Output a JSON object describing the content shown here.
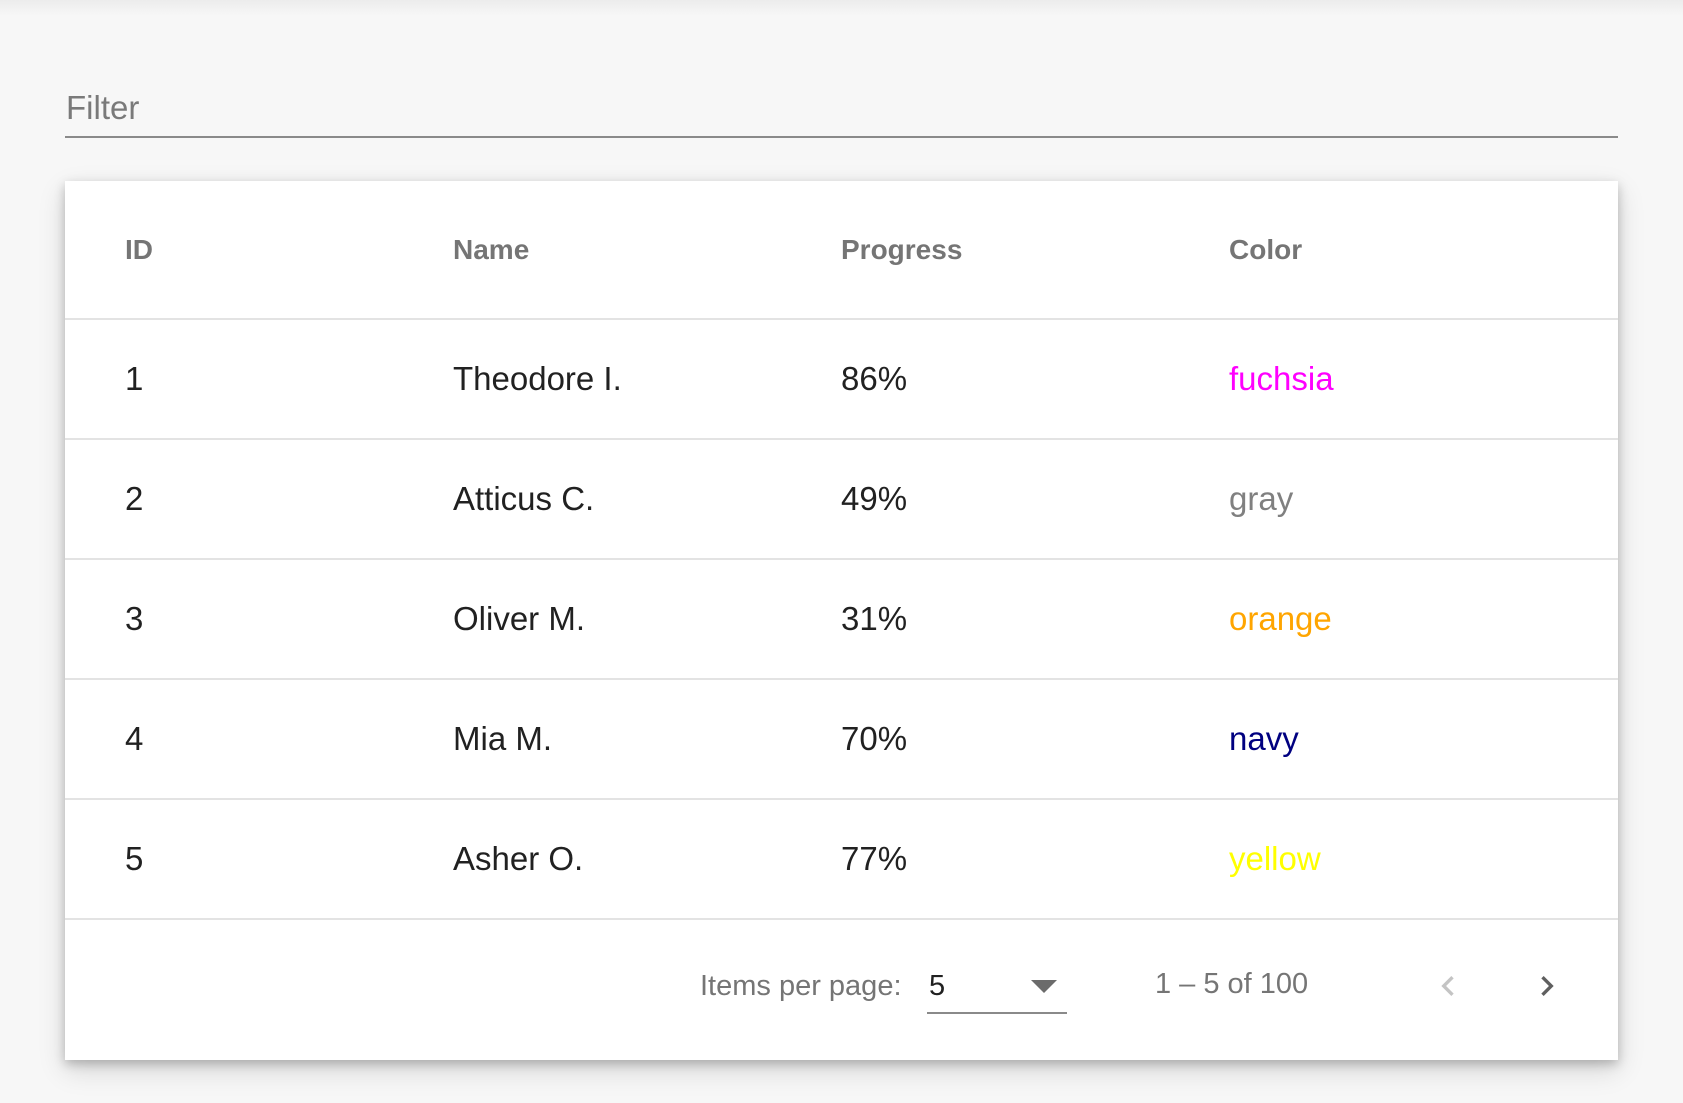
{
  "filter": {
    "placeholder": "Filter",
    "value": ""
  },
  "table": {
    "columns": [
      "ID",
      "Name",
      "Progress",
      "Color"
    ],
    "rows": [
      {
        "id": "1",
        "name": "Theodore I.",
        "progress": "86%",
        "color": "fuchsia",
        "color_hex": "#ff00ff"
      },
      {
        "id": "2",
        "name": "Atticus C.",
        "progress": "49%",
        "color": "gray",
        "color_hex": "#808080"
      },
      {
        "id": "3",
        "name": "Oliver M.",
        "progress": "31%",
        "color": "orange",
        "color_hex": "#ffa500"
      },
      {
        "id": "4",
        "name": "Mia M.",
        "progress": "70%",
        "color": "navy",
        "color_hex": "#000080"
      },
      {
        "id": "5",
        "name": "Asher O.",
        "progress": "77%",
        "color": "yellow",
        "color_hex": "#ffff00"
      }
    ]
  },
  "paginator": {
    "items_per_page_label": "Items per page:",
    "items_per_page_value": "5",
    "range_label": "1 – 5 of 100",
    "prev_icon": "chevron-left-icon",
    "next_icon": "chevron-right-icon",
    "prev_disabled": true,
    "next_disabled": false
  },
  "colors": {
    "page_background": "#f7f7f7",
    "card_background": "#ffffff",
    "header_text": "#757575",
    "cell_text": "#212121",
    "divider": "#e3e3e3"
  }
}
